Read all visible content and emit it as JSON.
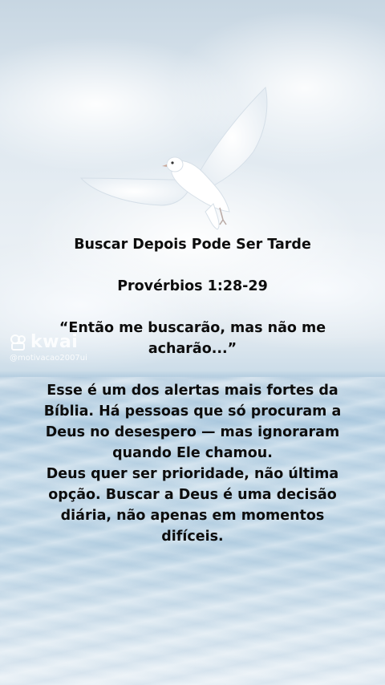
{
  "watermark": {
    "brand": "kwai",
    "handle": "@motivacao2007ui"
  },
  "post": {
    "title": "Buscar Depois Pode Ser Tarde",
    "reference": "Provérbios 1:28-29",
    "quote": "“Então me buscarão, mas não me acharão...”",
    "paragraph1": "Esse é um dos alertas mais fortes da Bíblia. Há pessoas que só procuram a Deus no desespero — mas ignoraram quando Ele chamou.",
    "paragraph2": "Deus quer ser prioridade, não última opção. Buscar a Deus é uma decisão diária, não apenas em momentos difíceis."
  },
  "icons": {
    "dove": "dove-icon",
    "watermark_logo": "kwai-logo-icon"
  }
}
